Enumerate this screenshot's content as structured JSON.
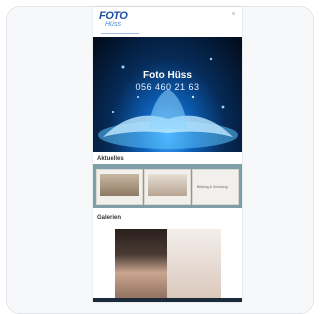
{
  "logo": {
    "main": "FOTO",
    "script": "Hüss"
  },
  "hero": {
    "title": "Foto Hüss",
    "phone": "056 460 21 63"
  },
  "sections": {
    "news": "Aktuelles",
    "gallery": "Galerien"
  },
  "news": [
    {
      "kind": "image"
    },
    {
      "kind": "image"
    },
    {
      "kind": "text",
      "text": "Bildung & Schulung"
    }
  ],
  "colors": {
    "brand": "#1f4fa3",
    "strip": "#7f9fa8"
  }
}
